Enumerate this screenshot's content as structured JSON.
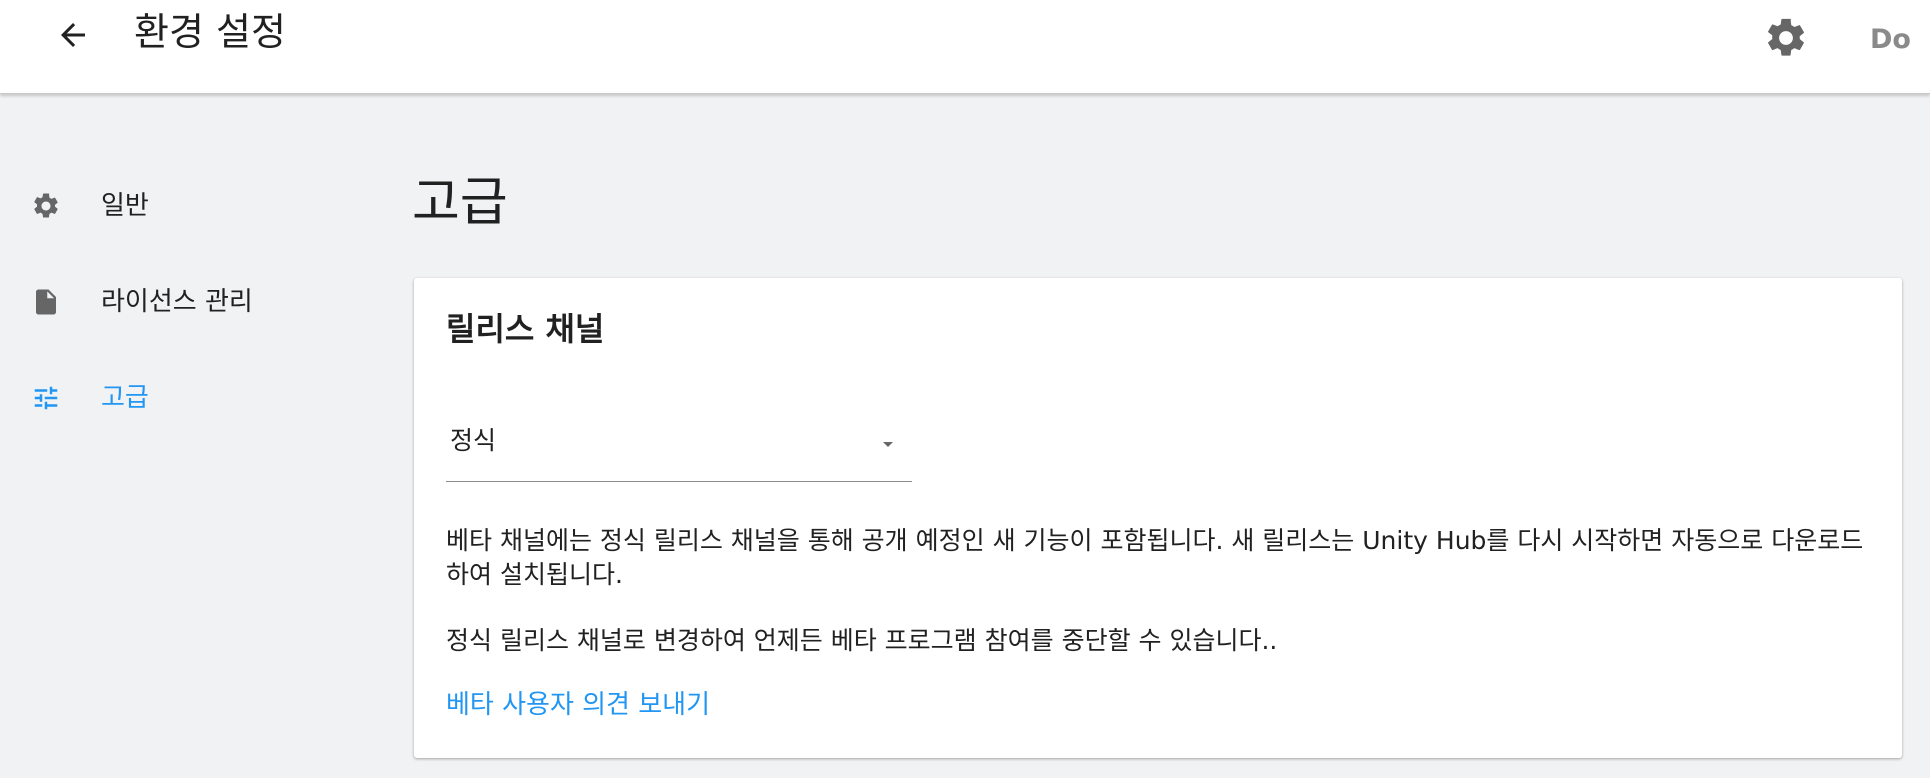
{
  "appbar": {
    "title": "환경 설정",
    "back_icon": "arrow-left-icon",
    "settings_icon": "gear-icon",
    "user_label": "Do"
  },
  "sidebar": {
    "items": [
      {
        "label": "일반",
        "icon": "gear-icon",
        "active": false
      },
      {
        "label": "라이선스 관리",
        "icon": "document-icon",
        "active": false
      },
      {
        "label": "고급",
        "icon": "tune-sliders-icon",
        "active": true
      }
    ]
  },
  "main": {
    "title": "고급",
    "card": {
      "title": "릴리스 채널",
      "select": {
        "value": "정식",
        "icon": "dropdown-arrow-icon"
      },
      "description": "베타 채널에는 정식 릴리스 채널을 통해 공개 예정인 새 기능이 포함됩니다. 새 릴리스는 Unity Hub를 다시 시작하면 자동으로 다운로드하여 설치됩니다.",
      "note": "정식 릴리스 채널로 변경하여 언제든 베타 프로그램 참여를 중단할 수 있습니다..",
      "link": "베타 사용자 의견 보내기"
    }
  },
  "colors": {
    "accent": "#2196f3",
    "background": "#f1f2f4",
    "card": "#ffffff",
    "icon": "#666666",
    "text": "#212121"
  }
}
